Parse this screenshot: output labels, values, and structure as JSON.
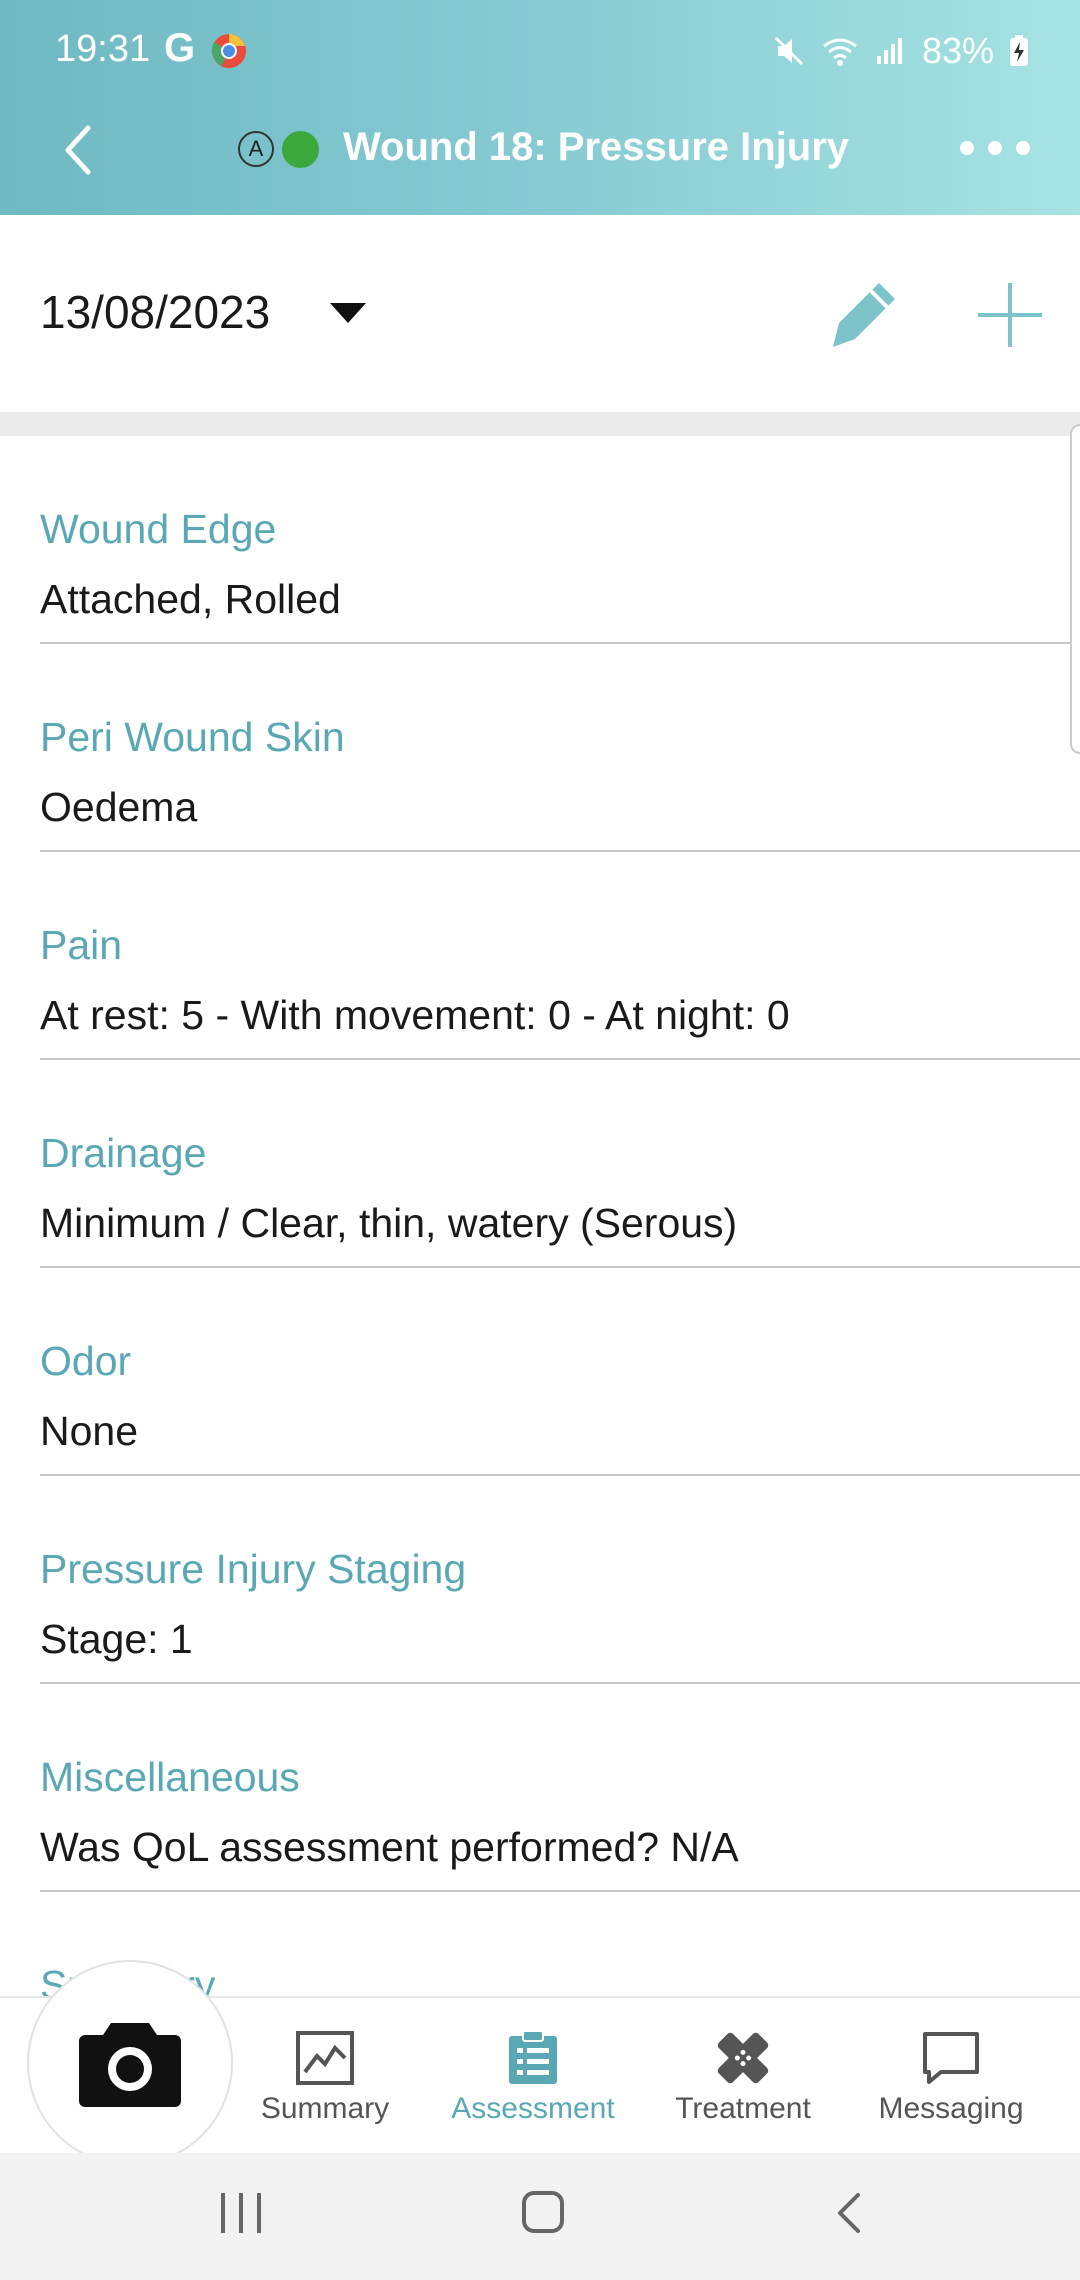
{
  "status_bar": {
    "time": "19:31",
    "g_label": "G",
    "battery": "83%"
  },
  "app_bar": {
    "badge": "A",
    "title": "Wound 18: Pressure Injury",
    "status_color": "#3aa83a"
  },
  "date_bar": {
    "date": "13/08/2023"
  },
  "fields": [
    {
      "label": "Wound Edge",
      "value": "Attached, Rolled"
    },
    {
      "label": "Peri Wound Skin",
      "value": "Oedema"
    },
    {
      "label": "Pain",
      "value": "At rest: 5 - With movement: 0 - At night: 0"
    },
    {
      "label": "Drainage",
      "value": "Minimum / Clear, thin, watery (Serous)"
    },
    {
      "label": "Odor",
      "value": "None"
    },
    {
      "label": "Pressure Injury Staging",
      "value": "Stage: 1"
    },
    {
      "label": "Miscellaneous",
      "value": "Was QoL assessment performed? N/A"
    },
    {
      "label": "Summary",
      "value": ""
    }
  ],
  "bottom_nav": {
    "items": [
      {
        "label": "Summary",
        "icon": "chart-icon"
      },
      {
        "label": "Assessment",
        "icon": "clipboard-icon",
        "active": true
      },
      {
        "label": "Treatment",
        "icon": "bandage-icon"
      },
      {
        "label": "Messaging",
        "icon": "chat-icon"
      }
    ]
  },
  "colors": {
    "accent": "#5aa8b3",
    "header_start": "#6fb9c3",
    "header_end": "#a6e3e3",
    "divider": "#c8c8c8"
  }
}
